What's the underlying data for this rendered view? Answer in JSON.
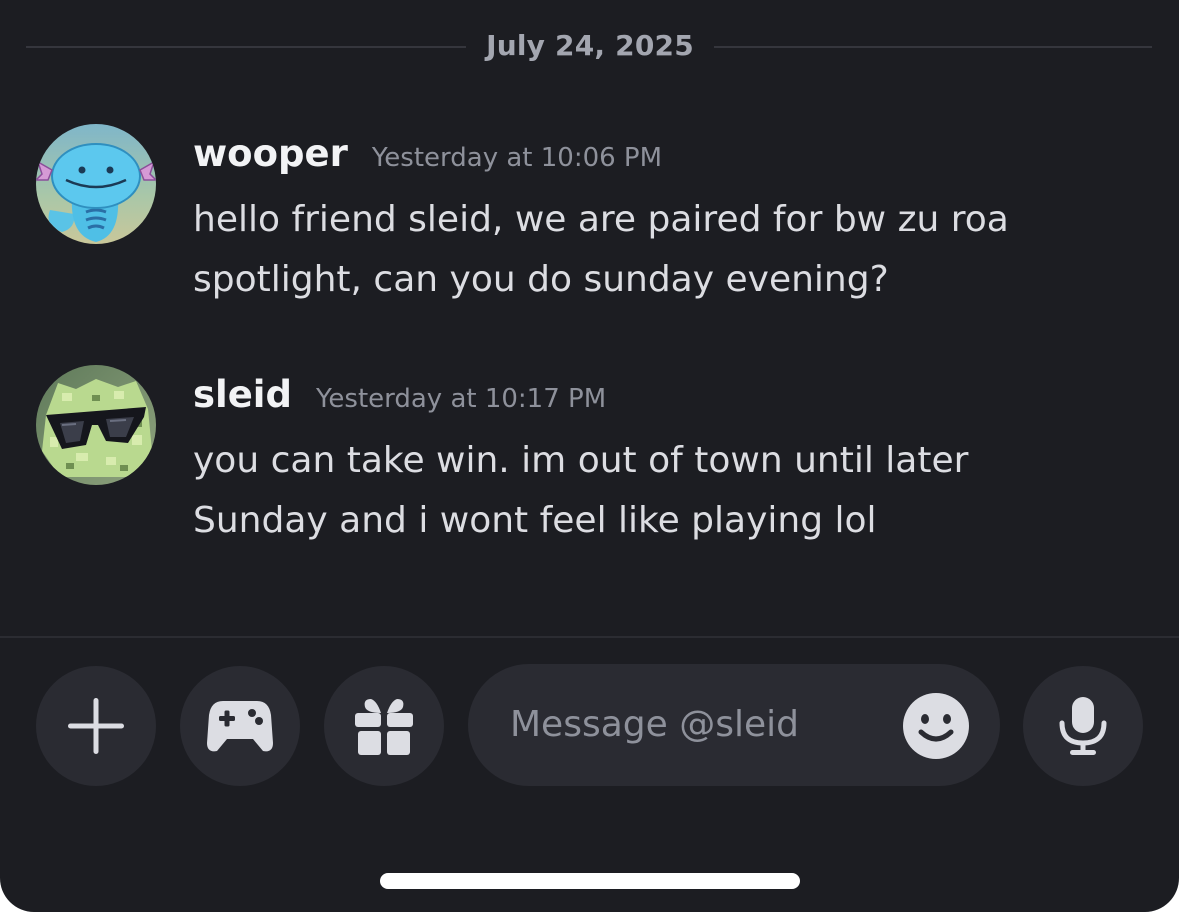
{
  "date_divider": "July 24, 2025",
  "messages": [
    {
      "username": "wooper",
      "timestamp": "Yesterday at 10:06 PM",
      "text": "hello friend sleid, we are paired for bw zu roa spotlight, can you do sunday evening?",
      "avatar_icon": "wooper-avatar"
    },
    {
      "username": "sleid",
      "timestamp": "Yesterday at 10:17 PM",
      "text": "you can take win. im out of town until later Sunday and i wont feel like playing lol",
      "avatar_icon": "sunglasses-frog-avatar"
    }
  ],
  "composer": {
    "placeholder": "Message @sleid",
    "value": "",
    "icons": [
      "plus-icon",
      "gamepad-icon",
      "gift-icon",
      "emoji-icon",
      "microphone-icon"
    ]
  },
  "colors": {
    "background": "#1c1d22",
    "button_bg": "#2a2b32",
    "icon": "#dcdde3",
    "username": "#f2f3f5",
    "timestamp": "#8e919b",
    "message_text": "#dcdde2"
  }
}
